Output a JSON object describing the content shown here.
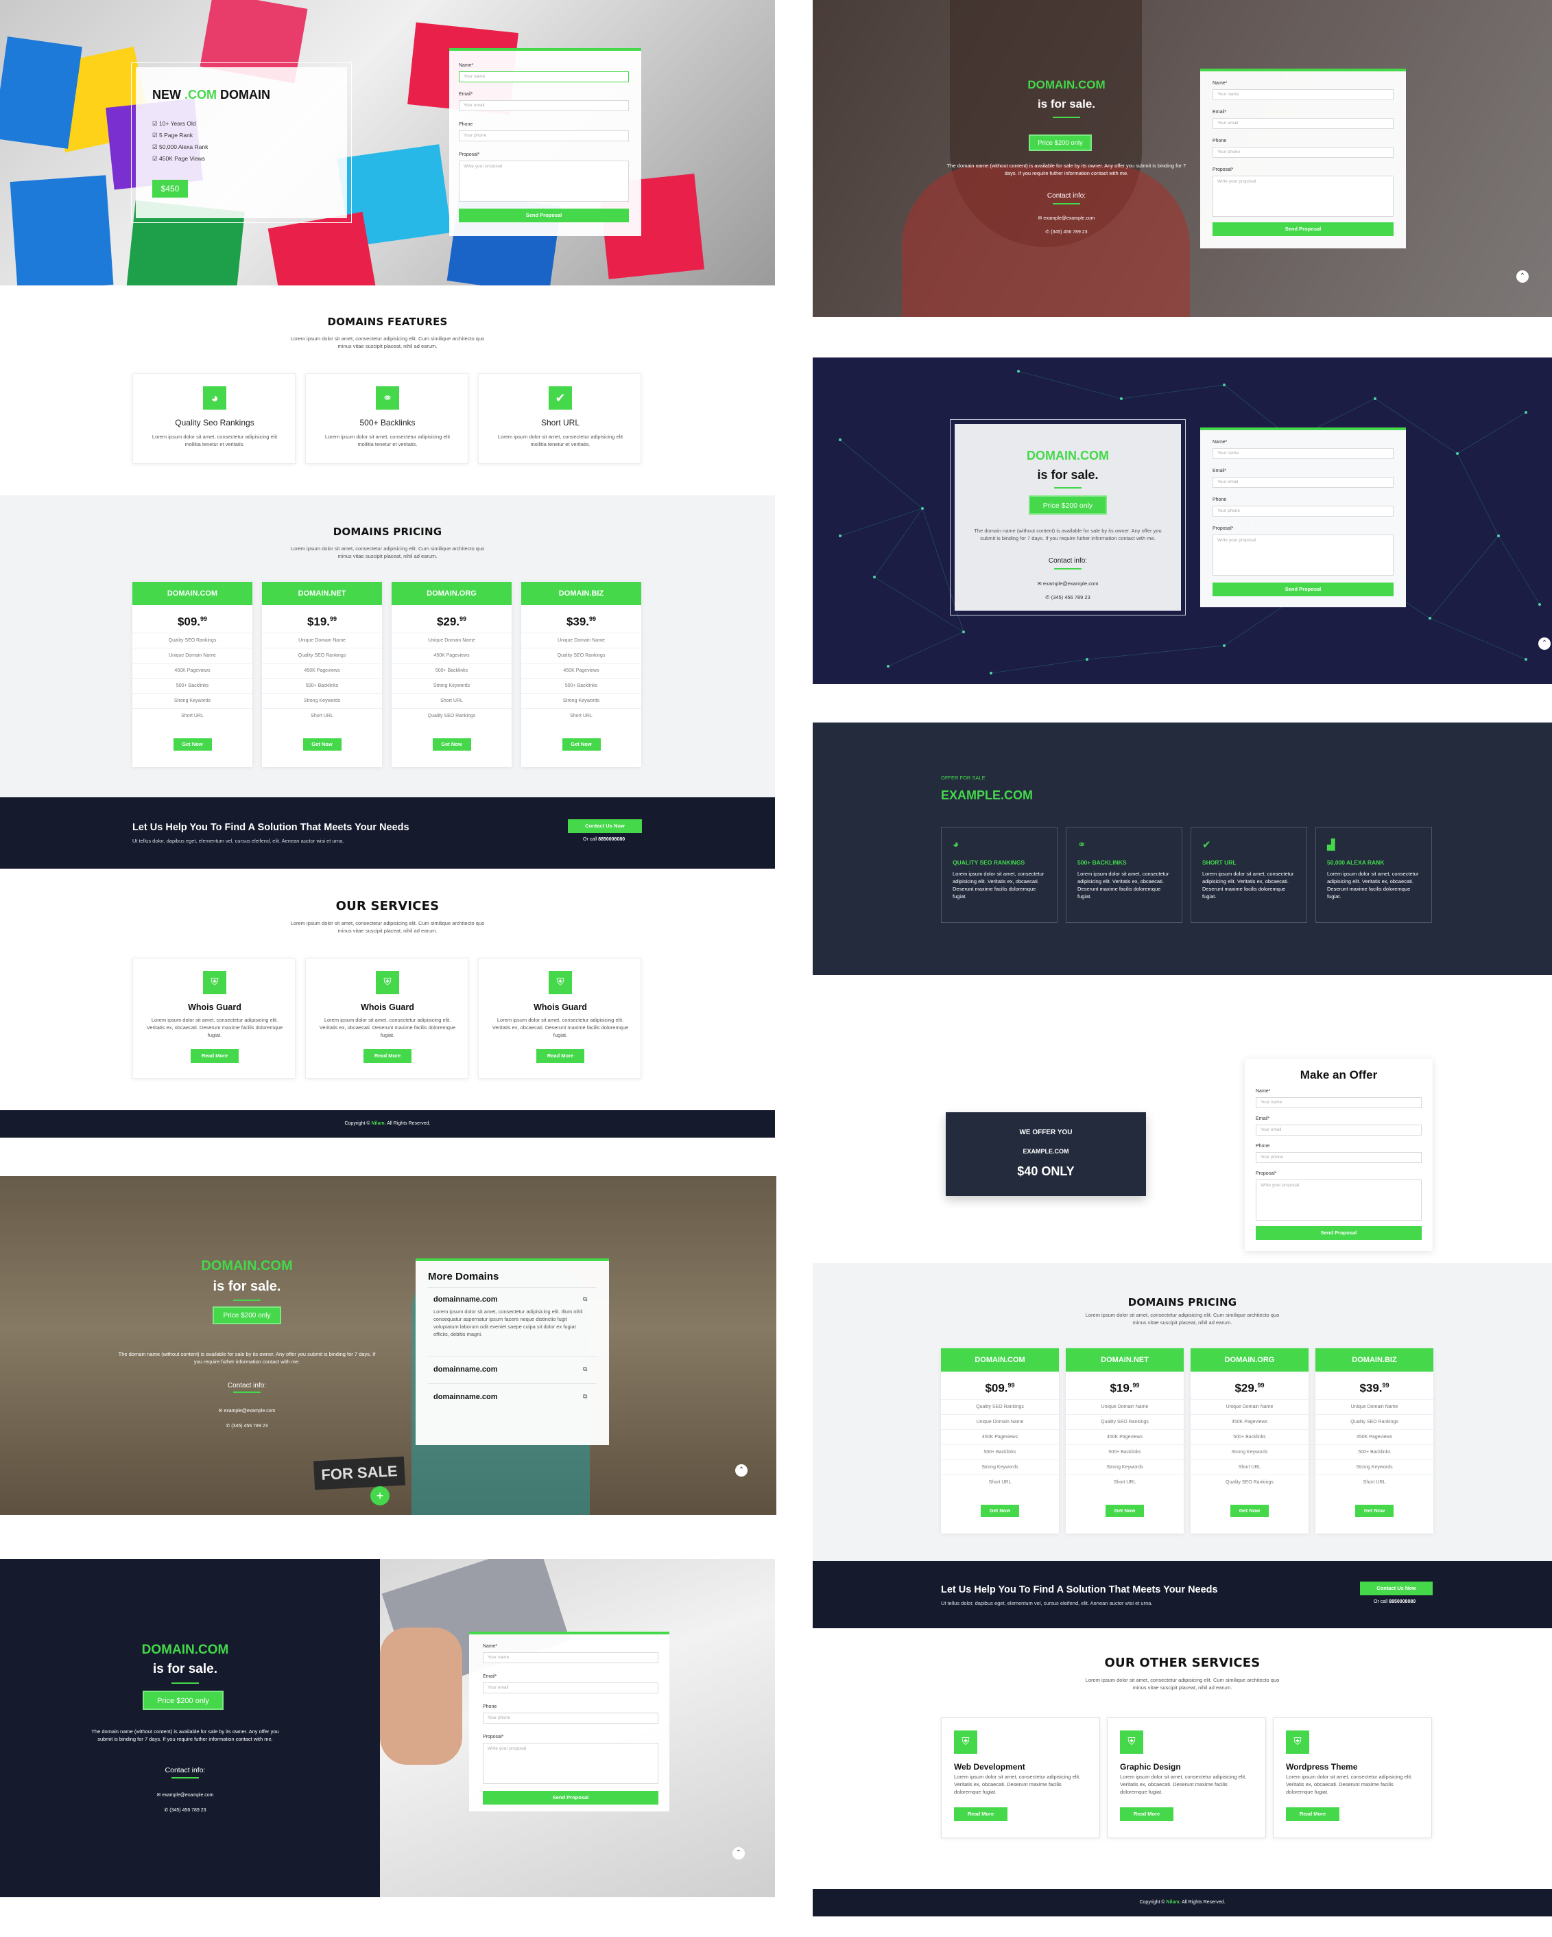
{
  "colors": {
    "accent": "#44d84a",
    "dark": "#151b2d",
    "navy": "#1b1d45",
    "light": "#f2f3f5"
  },
  "p1": {
    "hero": {
      "title_prefix": "NEW",
      "title_accent": ".COM",
      "title_suffix": "DOMAIN",
      "features": [
        "10+ Years Old",
        "5 Page Rank",
        "50,000 Alexa Rank",
        "450K Page Views"
      ],
      "price": "$450",
      "form": {
        "name_label": "Name*",
        "name_ph": "Your name",
        "email_label": "Email*",
        "email_ph": "Your email",
        "phone_label": "Phone",
        "phone_ph": "Your phone",
        "proposal_label": "Proposal*",
        "proposal_ph": "Write your proposal",
        "submit": "Send Proposal"
      }
    },
    "features": {
      "title": "DOMAINS FEATURES",
      "subtitle": "Lorem ipsum dolor sit amet, consectetur adipisicing elit. Cum similique architecto quo minus vitae suscipit placeat, nihil ad earum.",
      "cards": [
        {
          "icon": "globe-icon",
          "glyph": "◕",
          "title": "Quality Seo Rankings",
          "text": "Lorem ipsum dolor sit amet, consectetur adipisicing elit mollitia tenetur et veritatis."
        },
        {
          "icon": "link-icon",
          "glyph": "⚭",
          "title": "500+ Backlinks",
          "text": "Lorem ipsum dolor sit amet, consectetur adipisicing elit mollitia tenetur et veritatis."
        },
        {
          "icon": "check-icon",
          "glyph": "✔",
          "title": "Short URL",
          "text": "Lorem ipsum dolor sit amet, consectetur adipisicing elit mollitia tenetur et veritatis."
        }
      ]
    },
    "pricing": {
      "title": "DOMAINS PRICING",
      "subtitle": "Lorem ipsum dolor sit amet, consectetur adipisicing elit. Cum similique architecto quo minus vitae suscipit placeat, nihil ad earum.",
      "plans": [
        {
          "name": "DOMAIN.COM",
          "price": "$09.",
          "cents": "99",
          "features": [
            "Quality SEO Rankings",
            "Unique Domain Name",
            "450K Pageviews",
            "500+ Backlinks",
            "Strong Keywords",
            "Short URL"
          ],
          "button": "Get Now"
        },
        {
          "name": "DOMAIN.NET",
          "price": "$19.",
          "cents": "99",
          "features": [
            "Unique Domain Name",
            "Quality SEO Rankings",
            "450K Pageviews",
            "500+ Backlinks",
            "Strong Keywords",
            "Short URL"
          ],
          "button": "Get Now"
        },
        {
          "name": "DOMAIN.ORG",
          "price": "$29.",
          "cents": "99",
          "features": [
            "Unique Domain Name",
            "450K Pageviews",
            "500+ Backlinks",
            "Strong Keywords",
            "Short URL",
            "Quality SEO Rankings"
          ],
          "button": "Get Now"
        },
        {
          "name": "DOMAIN.BIZ",
          "price": "$39.",
          "cents": "99",
          "features": [
            "Unique Domain Name",
            "Quality SEO Rankings",
            "450K Pageviews",
            "500+ Backlinks",
            "Strong Keywords",
            "Short URL"
          ],
          "button": "Get Now"
        }
      ]
    },
    "cta": {
      "title": "Let Us Help You To Find A Solution That Meets Your Needs",
      "text": "Ut tellus dolor, dapibus eget, elementum vel, cursus eleifend, elit. Aenean auctor wisi et urna.",
      "button": "Contact Us Now",
      "call_prefix": "Or call",
      "call_number": "8850008080"
    },
    "services": {
      "title": "OUR SERVICES",
      "subtitle": "Lorem ipsum dolor sit amet, consectetur adipisicing elit. Cum similique architecto quo minus vitae suscipit placeat, nihil ad earum.",
      "cards": [
        {
          "title": "Whois Guard",
          "text": "Lorem ipsum dolor sit amet, consectetur adipisicing elit. Veritatis ex, obcaecati. Deserunt maxime facilis doloremque fugiat.",
          "button": "Read More"
        },
        {
          "title": "Whois Guard",
          "text": "Lorem ipsum dolor sit amet, consectetur adipisicing elit. Veritatis ex, obcaecati. Deserunt maxime facilis doloremque fugiat.",
          "button": "Read More"
        },
        {
          "title": "Whois Guard",
          "text": "Lorem ipsum dolor sit amet, consectetur adipisicing elit. Veritatis ex, obcaecati. Deserunt maxime facilis doloremque fugiat.",
          "button": "Read More"
        }
      ]
    },
    "footer": {
      "prefix": "Copyright ©",
      "brand": "Nilam.",
      "suffix": "All Rights Reserved."
    }
  },
  "sale": {
    "domain": "DOMAIN.COM",
    "is_for_sale": "is for sale.",
    "price": "Price $200 only",
    "description": "The domain name (without content) is available for sale by its owner. Any offer you submit is binding for 7 days. If you require futher information contact with me.",
    "contact_title": "Contact info:",
    "email": "example@example.com",
    "phone": "(345) 456 789 23"
  },
  "more_domains": {
    "title": "More Domains",
    "items": [
      {
        "name": "domainname.com",
        "text": "Lorem ipsum dolor sit amet, consectetur adipisicing elit. Illum nihil consequatur aspernatur ipsum facere neque distinctio fugit voluptatum laborum odit eveniet saepe culpa sit dolor ex fugiat officiis, debitis magni."
      },
      {
        "name": "domainname.com",
        "text": ""
      },
      {
        "name": "domainname.com",
        "text": ""
      }
    ]
  },
  "overlay_banner": "FOR SALE",
  "offer": {
    "tag": "OFFER FOR SALE",
    "domain": "EXAMPLE.COM",
    "features": [
      {
        "icon": "globe-icon",
        "glyph": "◕",
        "title": "QUALITY SEO RANKINGS",
        "text": "Lorem ipsum dolor sit amet, consectetur adipisicing elit. Veritatis ex, obcaecati. Deserunt maxime facilis doloremque fugiat."
      },
      {
        "icon": "link-icon",
        "glyph": "⚭",
        "title": "500+ BACKLINKS",
        "text": "Lorem ipsum dolor sit amet, consectetur adipisicing elit. Veritatis ex, obcaecati. Deserunt maxime facilis doloremque fugiat."
      },
      {
        "icon": "check-icon",
        "glyph": "✔",
        "title": "SHORT URL",
        "text": "Lorem ipsum dolor sit amet, consectetur adipisicing elit. Veritatis ex, obcaecati. Deserunt maxime facilis doloremque fugiat."
      },
      {
        "icon": "chart-icon",
        "glyph": "▟",
        "title": "50,000 ALEXA RANK",
        "text": "Lorem ipsum dolor sit amet, consectetur adipisicing elit. Veritatis ex, obcaecati. Deserunt maxime facilis doloremque fugiat."
      }
    ],
    "make_offer_title": "Make an Offer",
    "we_offer": "WE OFFER YOU",
    "we_domain": "EXAMPLE.COM",
    "we_price": "$40 ONLY"
  },
  "p8": {
    "pricing_title": "DOMAINS PRICING",
    "cta_title": "Let Us Help You To Find A Solution That Meets Your Needs",
    "services_title": "OUR OTHER SERVICES",
    "services": [
      {
        "title": "Web Development",
        "text": "Lorem ipsum dolor sit amet, consectetur adipisicing elit. Veritatis ex, obcaecati. Deserunt maxime facilis doloremque fugiat.",
        "button": "Read More"
      },
      {
        "title": "Graphic Design",
        "text": "Lorem ipsum dolor sit amet, consectetur adipisicing elit. Veritatis ex, obcaecati. Deserunt maxime facilis doloremque fugiat.",
        "button": "Read More"
      },
      {
        "title": "Wordpress Theme",
        "text": "Lorem ipsum dolor sit amet, consectetur adipisicing elit. Veritatis ex, obcaecati. Deserunt maxime facilis doloremque fugiat.",
        "button": "Read More"
      }
    ]
  }
}
